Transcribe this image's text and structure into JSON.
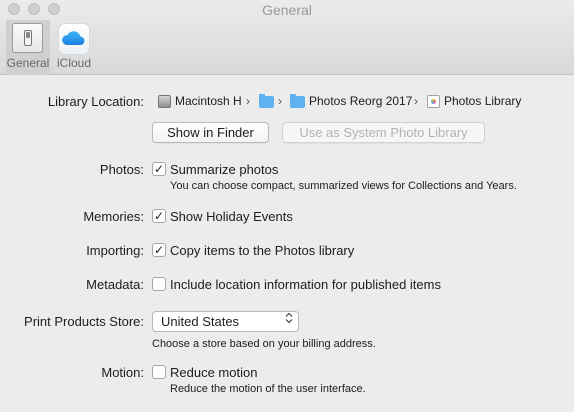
{
  "window": {
    "title": "General"
  },
  "toolbar": {
    "tabs": [
      {
        "label": "General",
        "icon": "general-switch-icon",
        "selected": true
      },
      {
        "label": "iCloud",
        "icon": "icloud-icon",
        "selected": false
      }
    ]
  },
  "library": {
    "label": "Library Location:",
    "path": [
      {
        "label": "Macintosh H",
        "icon": "hard-disk-icon"
      },
      {
        "label": "",
        "icon": "folder-icon"
      },
      {
        "label": "Photos Reorg 2017",
        "icon": "folder-icon"
      },
      {
        "label": "Photos Library",
        "icon": "photos-library-icon"
      }
    ],
    "show_in_finder": "Show in Finder",
    "use_as_system": "Use as System Photo Library"
  },
  "photos": {
    "label": "Photos:",
    "checkbox_label": "Summarize photos",
    "checked": true,
    "description": "You can choose compact, summarized views for Collections and Years."
  },
  "memories": {
    "label": "Memories:",
    "checkbox_label": "Show Holiday Events",
    "checked": true
  },
  "importing": {
    "label": "Importing:",
    "checkbox_label": "Copy items to the Photos library",
    "checked": true
  },
  "metadata": {
    "label": "Metadata:",
    "checkbox_label": "Include location information for published items",
    "checked": false
  },
  "print_store": {
    "label": "Print Products Store:",
    "selected": "United States",
    "description": "Choose a store based on your billing address."
  },
  "motion": {
    "label": "Motion:",
    "checkbox_label": "Reduce motion",
    "checked": false,
    "description": "Reduce the motion of the user interface."
  },
  "glyphs": {
    "check": "✓",
    "chevron": "›",
    "updown": "⌃⌄"
  },
  "colors": {
    "accent_folder": "#5db2ef",
    "window_bg": "#ececec"
  }
}
